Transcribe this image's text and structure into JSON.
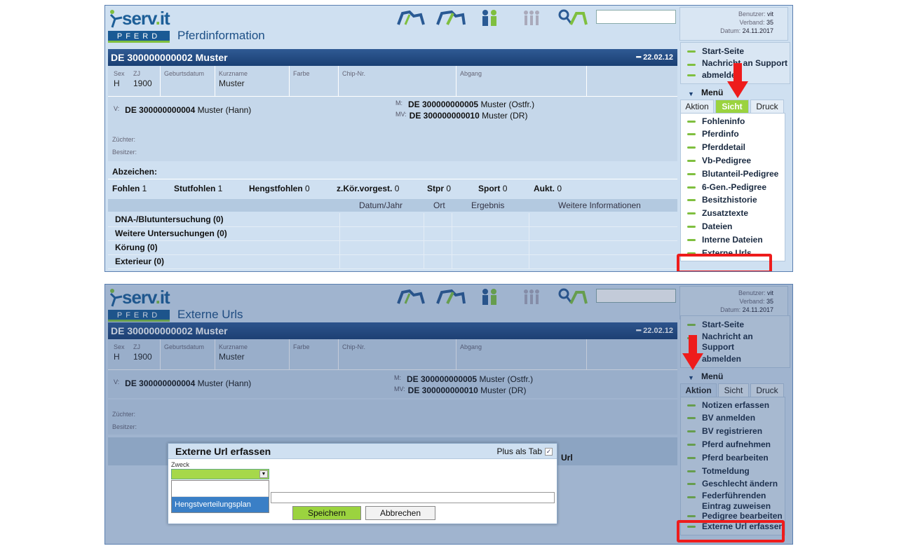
{
  "brand": {
    "logo_text_a": "serv",
    "logo_dot": ".",
    "logo_text_b": "it",
    "badge": "PFERD"
  },
  "user": {
    "benutzer_label": "Benutzer:",
    "benutzer": "vit",
    "verband_label": "Verband:",
    "verband": "35",
    "datum_label": "Datum:",
    "datum": "24.11.2017"
  },
  "horse": {
    "title": "DE 300000000002  Muster",
    "date": "22.02.12",
    "cols": {
      "sex": "Sex",
      "zj": "ZJ",
      "geburtsdatum": "Geburtsdatum",
      "kurzname": "Kurzname",
      "farbe": "Farbe",
      "chip": "Chip-Nr.",
      "abgang": "Abgang"
    },
    "values": {
      "sex": "H",
      "zj": "1900",
      "kurzname": "Muster"
    },
    "v_label": "V:",
    "v_id": "DE 300000000004",
    "v_name": "Muster (Hann)",
    "m_label": "M:",
    "m_id": "DE 300000000005",
    "m_name": "Muster (Ostfr.)",
    "mv_label": "MV:",
    "mv_id": "DE 300000000010",
    "mv_name": "Muster (DR)",
    "zuechter": "Züchter:",
    "besitzer": "Besitzer:"
  },
  "screen1": {
    "title": "Pferdinformation",
    "abzeichen": "Abzeichen:",
    "counts": [
      {
        "label": "Fohlen",
        "value": "1"
      },
      {
        "label": "Stutfohlen",
        "value": "1"
      },
      {
        "label": "Hengstfohlen",
        "value": "0"
      },
      {
        "label": "z.Kör.vorgest.",
        "value": "0"
      },
      {
        "label": "Stpr",
        "value": "0"
      },
      {
        "label": "Sport",
        "value": "0"
      },
      {
        "label": "Aukt.",
        "value": "0"
      }
    ],
    "table_headers": [
      "Datum/Jahr",
      "Ort",
      "Ergebnis",
      "Weitere Informationen"
    ],
    "rows": [
      "DNA-/Blutuntersuchung (0)",
      "Weitere Untersuchungen (0)",
      "Körung (0)",
      "Exterieur (0)"
    ],
    "nav_top": [
      "Start-Seite",
      "Nachricht an Support",
      "abmelden"
    ],
    "menu": "Menü",
    "tabs": [
      "Aktion",
      "Sicht",
      "Druck"
    ],
    "menu_items": [
      "Fohleninfo",
      "Pferdinfo",
      "Pferddetail",
      "Vb-Pedigree",
      "Blutanteil-Pedigree",
      "6-Gen.-Pedigree",
      "Besitzhistorie",
      "Zusatztexte",
      "Dateien",
      "Interne Dateien",
      "Externe Urls"
    ]
  },
  "screen2": {
    "title": "Externe Urls",
    "nav_top": [
      "Start-Seite",
      "Nachricht an",
      "Support",
      "abmelden"
    ],
    "menu": "Menü",
    "tabs": [
      "Aktion",
      "Sicht",
      "Druck"
    ],
    "menu_items": [
      "Notizen erfassen",
      "BV anmelden",
      "BV registrieren",
      "Pferd aufnehmen",
      "Pferd bearbeiten",
      "Totmeldung",
      "Geschlecht ändern",
      "Federführenden",
      "Eintrag zuweisen",
      "Pedigree bearbeiten",
      "Externe Url erfassen"
    ],
    "url_col": "Url",
    "dialog": {
      "title": "Externe Url erfassen",
      "plus_tab": "Plus als Tab",
      "zweck": "Zweck",
      "option": "Hengstverteilungsplan",
      "save": "Speichern",
      "cancel": "Abbrechen"
    }
  },
  "colors": {
    "accent_green": "#7fbf3f",
    "header_blue": "#1a3f73",
    "highlight_red": "#ee1c1c"
  }
}
